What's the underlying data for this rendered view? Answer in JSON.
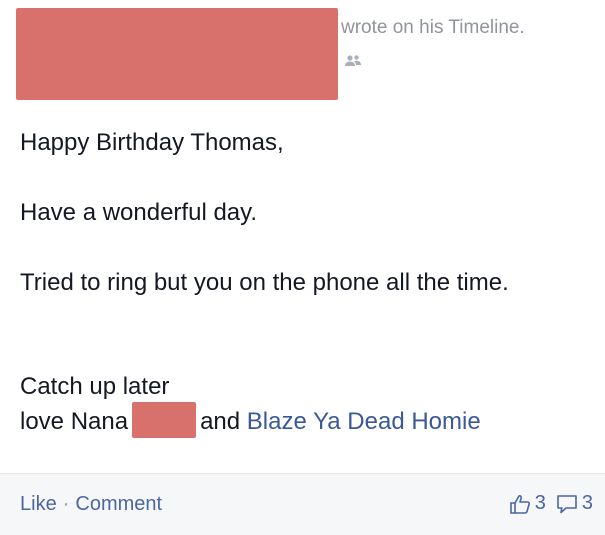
{
  "post": {
    "header_suffix": "wrote on his Timeline.",
    "audience_icon": "friends-icon"
  },
  "message": {
    "line1": "Happy Birthday Thomas,",
    "line2": "Have a wonderful day.",
    "line3": "Tried to ring but you on the phone all the time.",
    "line4": "Catch up later",
    "line5_prefix": "love Nana",
    "line5_middle": "and",
    "line5_link": "Blaze Ya Dead Homie"
  },
  "footer": {
    "like_label": "Like",
    "separator": "·",
    "comment_label": "Comment",
    "like_icon": "thumbs-up-icon",
    "like_count": "3",
    "comment_icon": "comment-bubble-icon",
    "comment_count": "3"
  },
  "colors": {
    "redaction": "#d8706c",
    "link": "#3b5998",
    "muted": "#90949c"
  }
}
